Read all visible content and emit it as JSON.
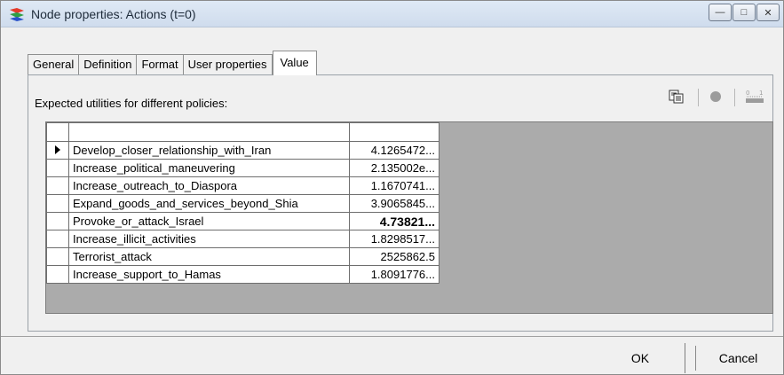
{
  "window": {
    "title": "Node properties: Actions (t=0)",
    "icon": "node-properties-app-icon"
  },
  "tabs": [
    {
      "label": "General"
    },
    {
      "label": "Definition"
    },
    {
      "label": "Format"
    },
    {
      "label": "User properties"
    },
    {
      "label": "Value",
      "active": true
    }
  ],
  "panel": {
    "label": "Expected utilities for different policies:",
    "toolbar_icons": [
      "copy-icon",
      "record-dot-icon",
      "ruler-icon"
    ]
  },
  "table": {
    "rows": [
      {
        "policy": "Develop_closer_relationship_with_Iran",
        "value": "4.1265472...",
        "selected": true
      },
      {
        "policy": "Increase_political_maneuvering",
        "value": "2.135002e..."
      },
      {
        "policy": "Increase_outreach_to_Diaspora",
        "value": "1.1670741..."
      },
      {
        "policy": "Expand_goods_and_services_beyond_Shia",
        "value": "3.9065845..."
      },
      {
        "policy": "Provoke_or_attack_Israel",
        "value": "4.73821...",
        "bold": true
      },
      {
        "policy": "Increase_illicit_activities",
        "value": "1.8298517..."
      },
      {
        "policy": "Terrorist_attack",
        "value": "2525862.5"
      },
      {
        "policy": "Increase_support_to_Hamas",
        "value": "1.8091776..."
      }
    ]
  },
  "buttons": {
    "ok": "OK",
    "cancel": "Cancel"
  },
  "colors": {
    "titlebar": "#dfe9f5",
    "dialog_bg": "#f0f0f0",
    "grid_bg": "#ababab"
  }
}
